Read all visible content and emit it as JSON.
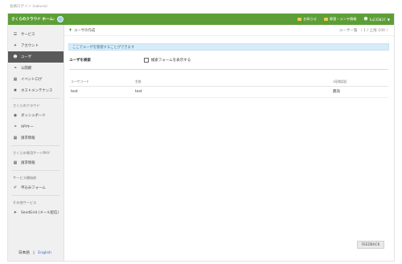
{
  "page": {
    "top_title": "会員ログイン (sakura)"
  },
  "topbar": {
    "title": "さくらのクラウド ホーム:",
    "items": [
      {
        "label": "お知らせ"
      },
      {
        "label": "障害・メンテ情報"
      },
      {
        "label": "fu235837"
      }
    ],
    "caret": "▼"
  },
  "sidebar": {
    "items": [
      {
        "label": "サービス",
        "icon": "list-icon"
      },
      {
        "label": "アカウント",
        "icon": "wrench-icon"
      },
      {
        "label": "ユーザ",
        "icon": "users-icon"
      },
      {
        "label": "公開鍵",
        "icon": "key-icon"
      },
      {
        "label": "イベントログ",
        "icon": "log-icon"
      },
      {
        "label": "ホストメンテナンス",
        "icon": "maintenance-icon"
      }
    ],
    "section_cloud": "さくらのクラウド",
    "cloud_items": [
      {
        "label": "ダッシュボード",
        "icon": "dashboard-icon"
      },
      {
        "label": "APIキー",
        "icon": "api-key-icon"
      },
      {
        "label": "請求情報",
        "icon": "billing-icon"
      }
    ],
    "section_dedicated": "さくらの専用サーバPHY",
    "dedicated_items": [
      {
        "label": "請求情報",
        "icon": "billing-icon"
      }
    ],
    "section_service_start": "サービス開始前",
    "service_start_items": [
      {
        "label": "申込みフォーム",
        "icon": "form-icon"
      }
    ],
    "section_others": "その他サービス",
    "others_items": [
      {
        "label": "SendGrid (メール配信)",
        "icon": "sendgrid-icon"
      }
    ],
    "lang_ja": "日本語",
    "lang_sep": "|",
    "lang_en": "English"
  },
  "main": {
    "add_user": "ユーザの作成",
    "user_count": "ユーザー覧 （ 1 / 上限 100 ）",
    "info": "ここでユーザを管理することができます",
    "search_label": "ユーザを検索",
    "show_search_form": "検索フォームを表示する",
    "table": {
      "headers": [
        "ユーザコード",
        "名前",
        "2段階認証"
      ],
      "rows": [
        [
          "test",
          "test",
          "無効"
        ]
      ]
    },
    "feedback": "FEEDBACK"
  }
}
